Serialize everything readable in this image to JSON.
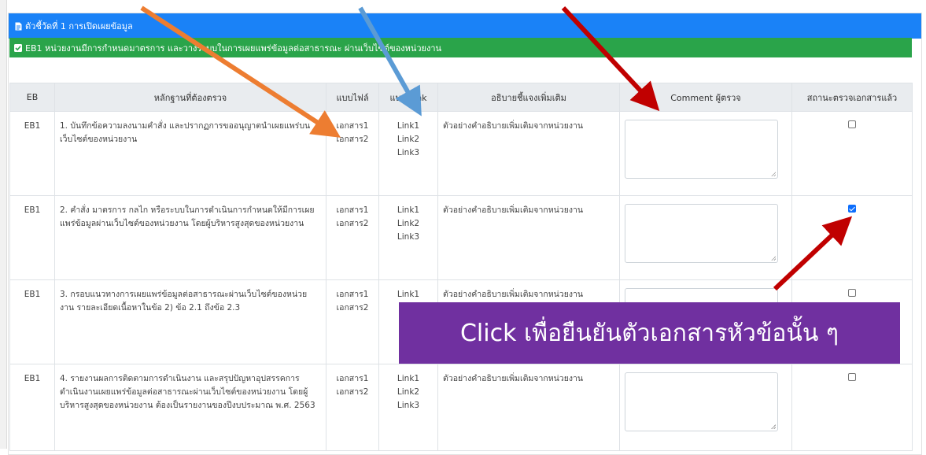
{
  "colors": {
    "panel_header_bg": "#1a82f7",
    "card_header_bg": "#2aa44a",
    "callout_bg": "#7030a0",
    "arrow_orange": "#ed7d31",
    "arrow_blue": "#5b9bd5",
    "arrow_red": "#c00000",
    "checkbox_checked": "#0d6efd"
  },
  "panel": {
    "icon": "document-icon",
    "title": "ตัวชี้วัดที่ 1 การเปิดเผยข้อมูล"
  },
  "card": {
    "icon": "checkbox-checked-icon",
    "title": "EB1 หน่วยงานมีการกำหนดมาตรการ และวางระบบในการเผยแพร่ข้อมูลต่อสาธารณะ ผ่านเว็บไซต์ของหน่วยงาน"
  },
  "table": {
    "headers": [
      "EB",
      "หลักฐานที่ต้องตรวจ",
      "แบบไฟล์",
      "แบบ Link",
      "อธิบายชี้แจงเพิ่มเติม",
      "Comment ผู้ตรวจ",
      "สถานะตรวจเอกสารแล้ว"
    ],
    "rows": [
      {
        "eb": "EB1",
        "evidence": "1. บันทึกข้อความลงนามคำสั่ง และปรากฏการขออนุญาตนำเผยแพร่บนเว็บไซต์ของหน่วยงาน",
        "files": [
          "เอกสาร1",
          "เอกสาร2"
        ],
        "links": [
          "Link1",
          "Link2",
          "Link3"
        ],
        "explain": "ตัวอย่างคำอธิบายเพิ่มเติมจากหน่วยงาน",
        "comment": "",
        "checked": false
      },
      {
        "eb": "EB1",
        "evidence": "2. คำสั่ง มาตรการ กลไก หรือระบบในการดำเนินการกำหนดให้มีการเผยแพร่ข้อมูลผ่านเว็บไซต์ของหน่วยงาน โดยผู้บริหารสูงสุดของหน่วยงาน",
        "files": [
          "เอกสาร1",
          "เอกสาร2"
        ],
        "links": [
          "Link1",
          "Link2",
          "Link3"
        ],
        "explain": "ตัวอย่างคำอธิบายเพิ่มเติมจากหน่วยงาน",
        "comment": "",
        "checked": true
      },
      {
        "eb": "EB1",
        "evidence": "3. กรอบแนวทางการเผยแพร่ข้อมูลต่อสาธารณะผ่านเว็บไซต์ของหน่วยงาน รายละเอียดเนื้อหาในข้อ 2) ข้อ 2.1 ถึงข้อ 2.3",
        "files": [
          "เอกสาร1",
          "เอกสาร2"
        ],
        "links": [
          "Link1"
        ],
        "explain": "ตัวอย่างคำอธิบายเพิ่มเติมจากหน่วยงาน",
        "comment": "",
        "checked": false
      },
      {
        "eb": "EB1",
        "evidence": "4. รายงานผลการติดตามการดำเนินงาน และสรุปปัญหาอุปสรรคการดำเนินงานเผยแพร่ข้อมูลต่อสาธารณะผ่านเว็บไซต์ของหน่วยงาน โดยผู้บริหารสูงสุดของหน่วยงาน ต้องเป็นรายงานของปีงบประมาณ พ.ศ. 2563",
        "files": [
          "เอกสาร1",
          "เอกสาร2"
        ],
        "links": [
          "Link1",
          "Link2",
          "Link3"
        ],
        "explain": "ตัวอย่างคำอธิบายเพิ่มเติมจากหน่วยงาน",
        "comment": "",
        "checked": false
      }
    ]
  },
  "callout": {
    "text": "Click เพื่อยืนยันตัวเอกสารหัวข้อนั้น ๆ"
  }
}
